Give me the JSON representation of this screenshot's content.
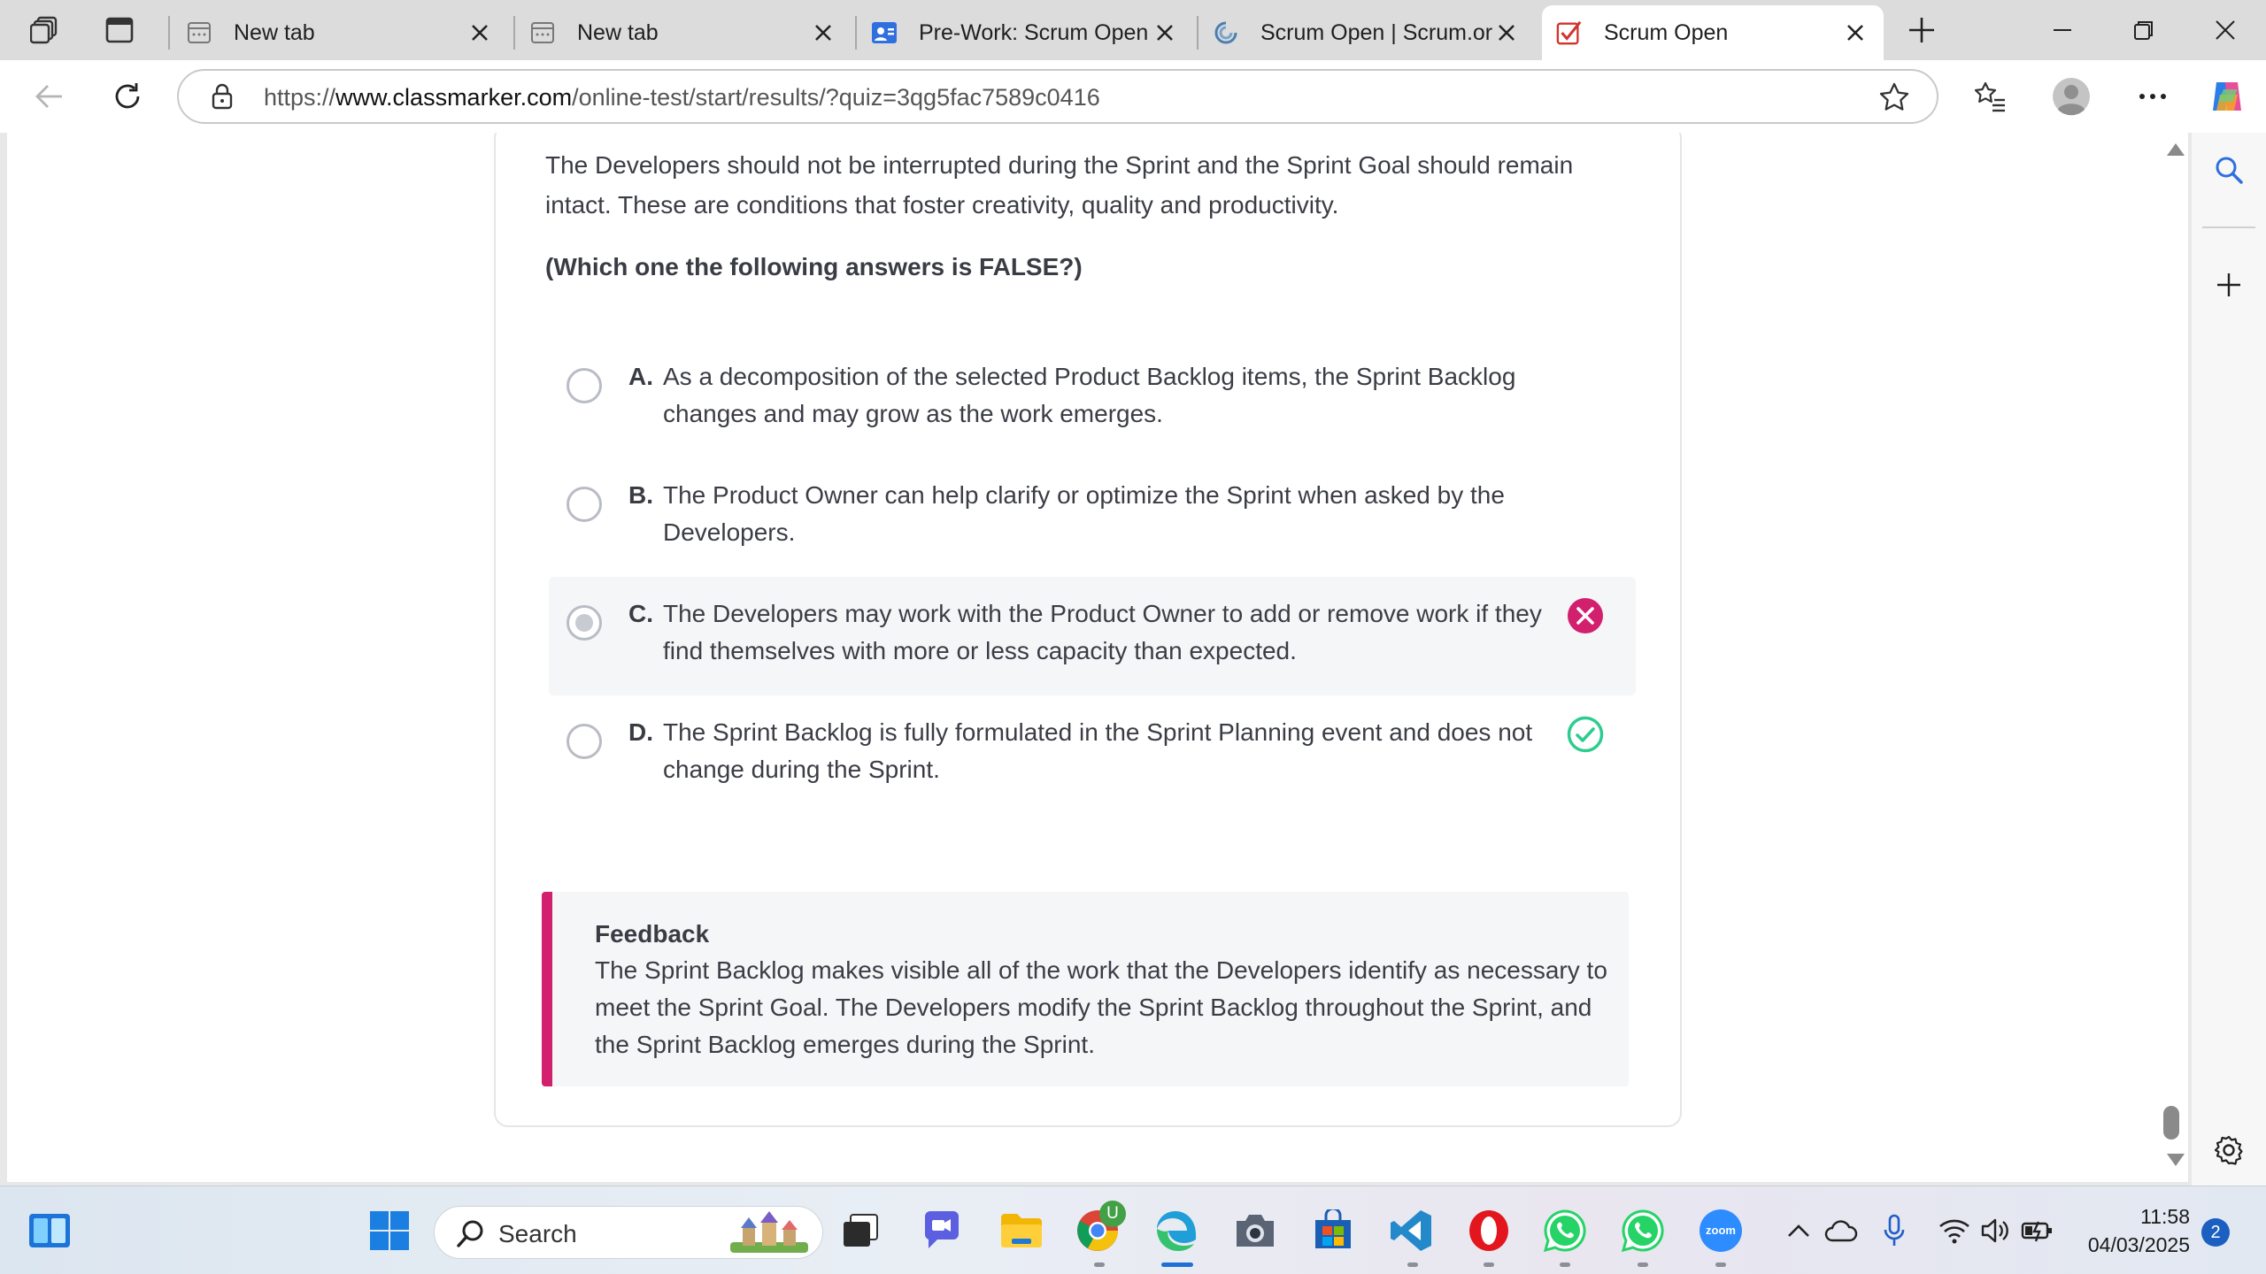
{
  "browser": {
    "tabs": [
      {
        "title": "New tab",
        "favicon": "page-icon"
      },
      {
        "title": "New tab",
        "favicon": "page-icon"
      },
      {
        "title": "Pre-Work: Scrum Open A",
        "favicon": "user-card-icon"
      },
      {
        "title": "Scrum Open | Scrum.org",
        "favicon": "scrum-logo-icon"
      },
      {
        "title": "Scrum Open",
        "favicon": "checkmark-icon",
        "active": true
      }
    ],
    "url_prefix": "https://",
    "url_domain": "www.classmarker.com",
    "url_path": "/online-test/start/results/?quiz=3qg5fac7589c0416"
  },
  "question": {
    "intro": "The Developers should not be interrupted during the Sprint and the Sprint Goal should remain intact. These are conditions that foster creativity, quality and productivity.",
    "prompt": "(Which one the following answers is FALSE?)",
    "options": [
      {
        "letter": "A.",
        "text": "As a decomposition of the selected Product Backlog items, the Sprint Backlog changes and may grow as the work emerges.",
        "selected": false
      },
      {
        "letter": "B.",
        "text": "The Product Owner can help clarify or optimize the Sprint when asked by the Developers.",
        "selected": false
      },
      {
        "letter": "C.",
        "text": "The Developers may work with the Product Owner to add or remove work if they find themselves with more or less capacity than expected.",
        "selected": true,
        "result": "incorrect"
      },
      {
        "letter": "D.",
        "text": "The Sprint Backlog is fully formulated in the Sprint Planning event and does not change during the Sprint.",
        "selected": false,
        "result": "correct"
      }
    ]
  },
  "feedback": {
    "title": "Feedback",
    "body": "The Sprint Backlog makes visible all of the work that the Developers identify as necessary to meet the Sprint Goal. The Developers modify the Sprint Backlog throughout the Sprint, and the Sprint Backlog emerges during the Sprint."
  },
  "colors": {
    "incorrect": "#d21f6e",
    "correct": "#2ecc8f",
    "accent_bar": "#d21f6e"
  },
  "taskbar": {
    "search_label": "Search",
    "time": "11:58",
    "date": "04/03/2025",
    "notifications": "2",
    "chrome_badge": "U",
    "zoom_label": "zoom"
  }
}
